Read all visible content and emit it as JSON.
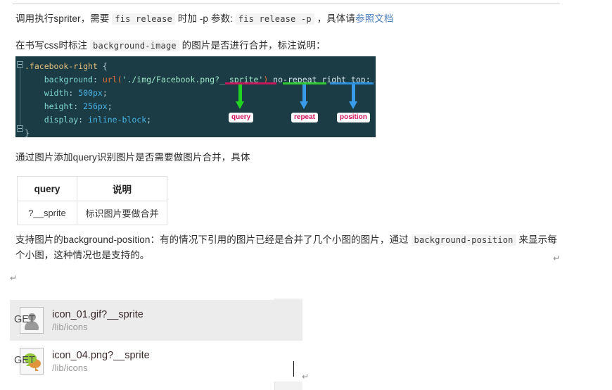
{
  "document": {
    "paragraph_1": {
      "seg_1": "调用执行spriter，需要 ",
      "code_1": "fis release",
      "seg_2": " 时加 -p 参数: ",
      "code_2": "fis release -p",
      "seg_3": " ，具体请",
      "link": "参照文档"
    },
    "paragraph_2": {
      "seg_1": "在书写css时标注 ",
      "code_1": "background-image",
      "seg_2": " 的图片是否进行合并，标注说明："
    },
    "paragraph_3": {
      "text": "通过图片添加query识别图片是否需要做图片合并，具体"
    },
    "paragraph_4": {
      "seg_1": "支持图片的background-position：有的情况下引用的图片已经是合并了几个小图的图片，通过 ",
      "code_1": "background-position",
      "seg_2": " 来显示每个小图，这种情况也是支持的。"
    }
  },
  "code_block": {
    "lines": [
      {
        "sel": ".facebook-right {"
      },
      {
        "prop": "background:",
        "fn": "url(",
        "str": "'./img/Facebook.png?__sprite'",
        "punc": ")",
        "plain": " no-repeat right top;"
      },
      {
        "prop": "width:",
        "val": "500px",
        "punc": ";"
      },
      {
        "prop": "height:",
        "val": "256px",
        "punc": ";"
      },
      {
        "prop": "display:",
        "val": "inline-block",
        "punc": ";"
      },
      {
        "sel": "}"
      }
    ],
    "raw": ".facebook-right {\n    background: url('./img/Facebook.png?__sprite') no-repeat right top;\n    width: 500px;\n    height: 256px;\n    display: inline-block;\n}",
    "annotations": [
      {
        "label": "query",
        "target": "__sprite'",
        "underline_color": "#c2185b",
        "arrow_color": "#22d422"
      },
      {
        "label": "repeat",
        "target": "no-repeat",
        "underline_color": "#2ecc2e",
        "arrow_color": "#3a9ce8"
      },
      {
        "label": "position",
        "target": "right top",
        "underline_color": "#2b8fe0",
        "arrow_color": "#3a9ce8"
      }
    ],
    "background_color": "#1b3b45",
    "label_text_color": "#d4145a"
  },
  "query_table": {
    "headers": [
      "query",
      "说明"
    ],
    "rows": [
      [
        "?__sprite",
        "标识图片要做合并"
      ]
    ]
  },
  "network_panel": {
    "rows": [
      {
        "name": "icon_01.gif?__sprite",
        "path": "/lib/icons",
        "method": "GET",
        "icon": "user-avatar-icon",
        "selected": true
      },
      {
        "name": "icon_04.png?__sprite",
        "path": "/lib/icons",
        "method": "GET",
        "icon": "chat-bubbles-icon",
        "selected": false
      }
    ]
  },
  "marks": {
    "return_symbol": "↵"
  }
}
